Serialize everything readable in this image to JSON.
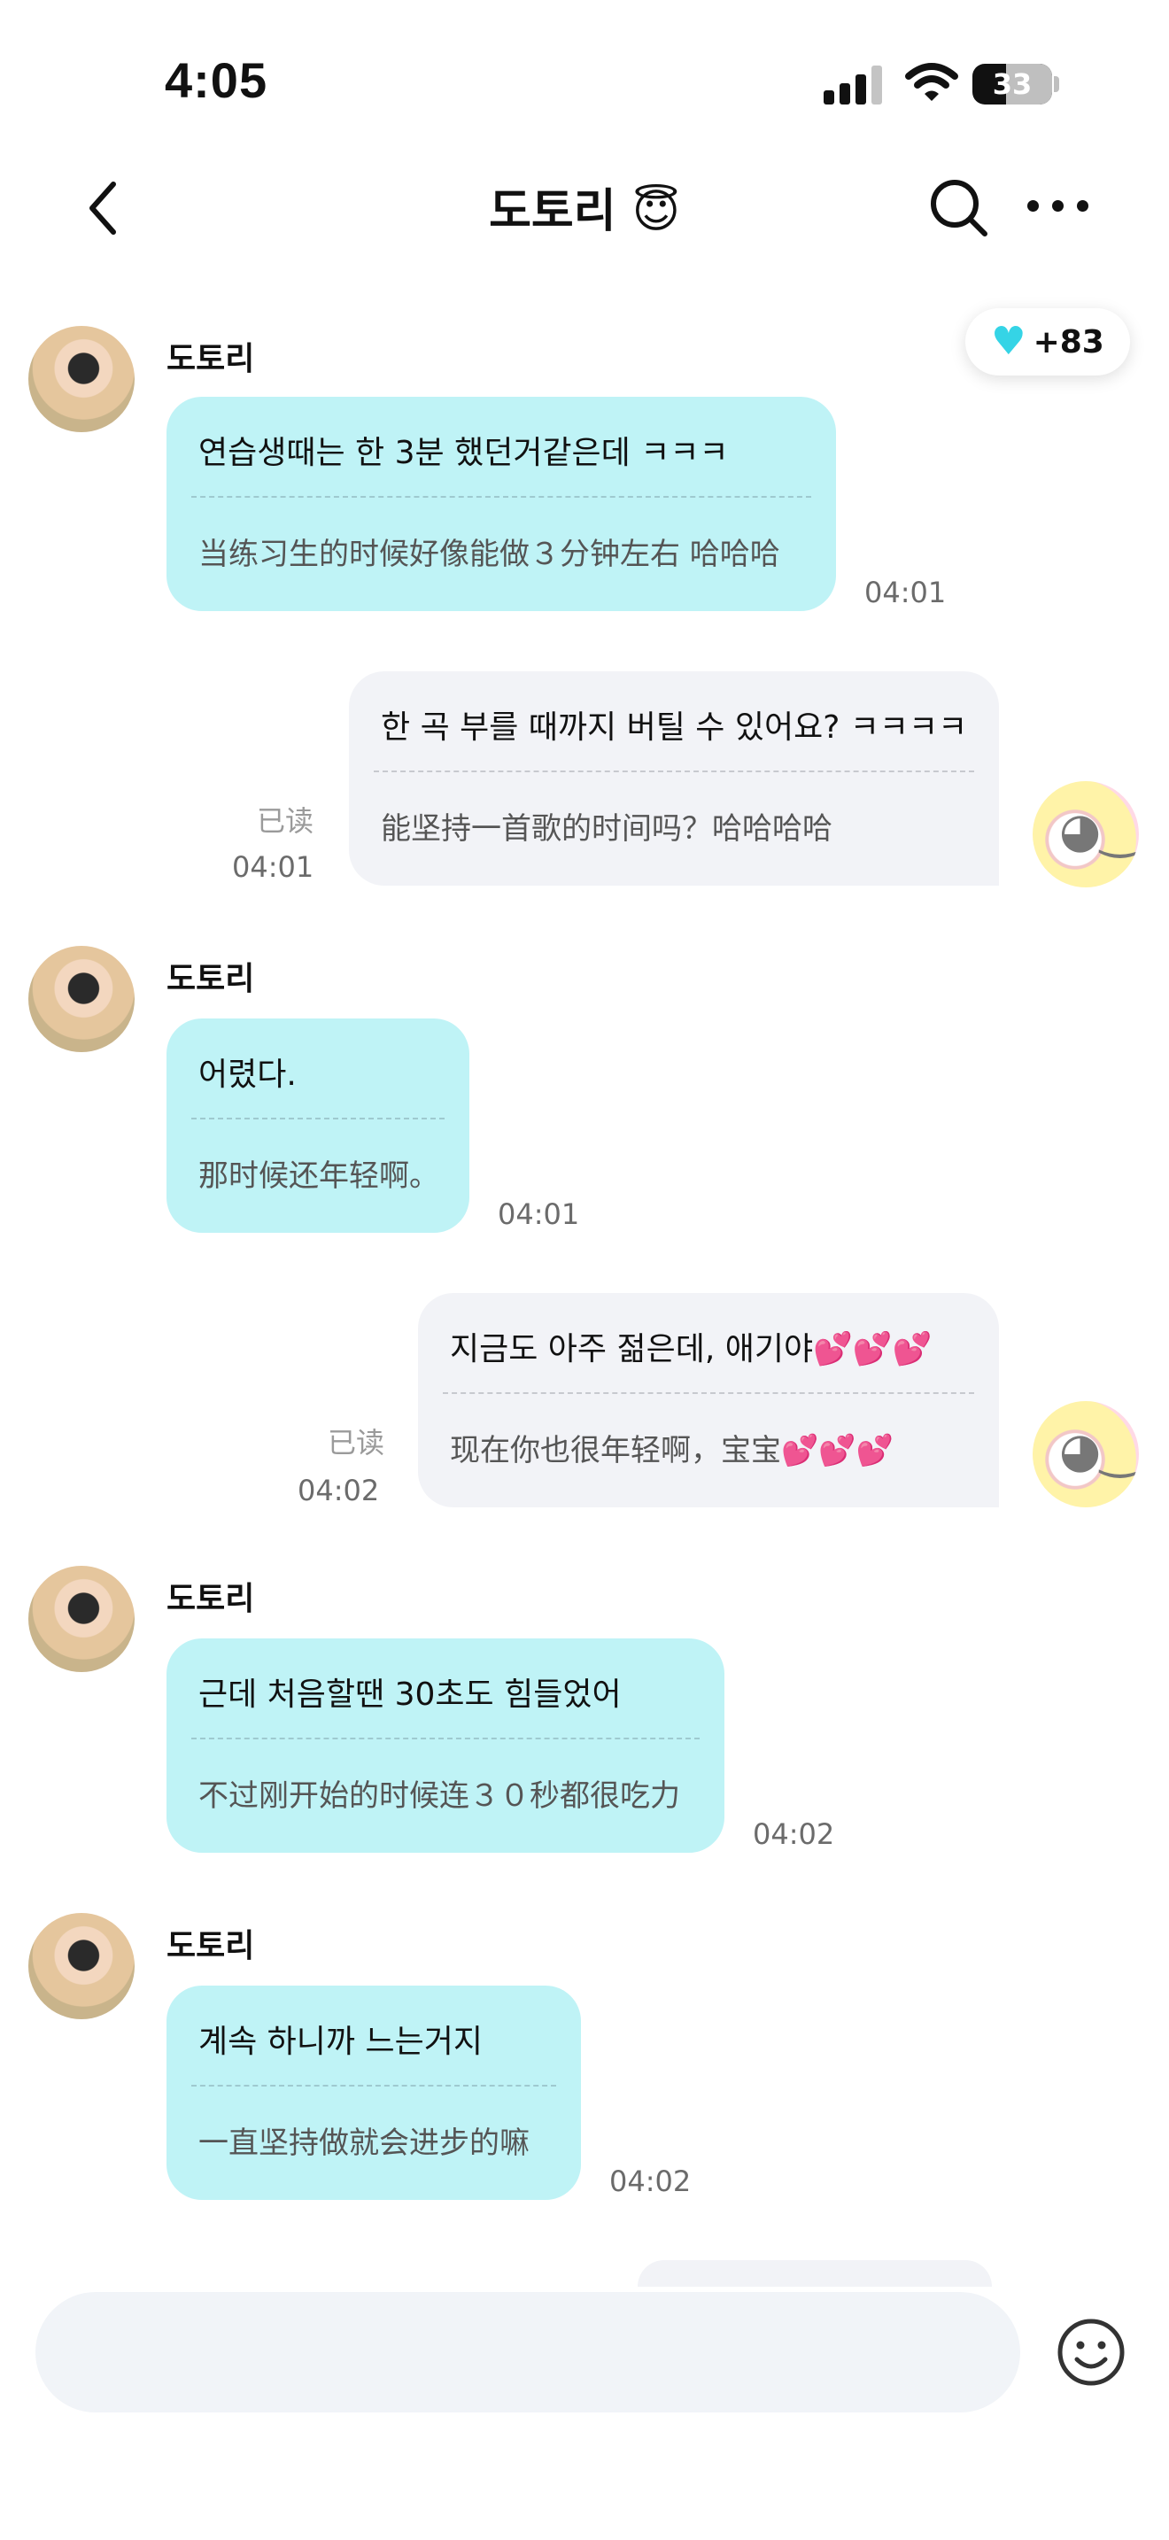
{
  "status_bar": {
    "time": "4:05",
    "battery": "33",
    "icons": [
      "cellular-signal-icon",
      "wifi-icon",
      "battery-icon"
    ]
  },
  "nav": {
    "title": "도토리 😇",
    "icons": [
      "back-chevron-icon",
      "search-icon",
      "more-icon"
    ]
  },
  "heart_badge": {
    "icon": "heart-icon",
    "count": "+83",
    "color": "#35d4e6"
  },
  "colors": {
    "incoming_bubble": "#bff3f6",
    "outgoing_bubble": "#f2f3f7"
  },
  "messages": [
    {
      "sender": "도토리",
      "text": "연습생때는 한 3분 했던거같은데 ㅋㅋㅋ",
      "translation": "当练习生的时候好像能做３分钟左右 哈哈哈",
      "time": "04:01"
    },
    {
      "text": "한 곡 부를 때까지 버틸 수 있어요? ㅋㅋㅋㅋ",
      "translation": "能坚持一首歌的时间吗？哈哈哈哈",
      "read": "已读",
      "time": "04:01"
    },
    {
      "sender": "도토리",
      "text": "어렸다.",
      "translation": "那时候还年轻啊。",
      "time": "04:01"
    },
    {
      "text": "지금도 아주 젊은데, 애기야💕💕💕",
      "translation": "现在你也很年轻啊，宝宝💕💕💕",
      "read": "已读",
      "time": "04:02"
    },
    {
      "sender": "도토리",
      "text": "근데 처음할땐 30초도 힘들었어",
      "translation": "不过刚开始的时候连３０秒都很吃力",
      "time": "04:02"
    },
    {
      "sender": "도토리",
      "text": "계속 하니까 느는거지",
      "translation": "一直坚持做就会进步的嘛",
      "time": "04:02"
    }
  ],
  "input_bar": {
    "placeholder": "",
    "emoji_icon": "smiley-icon"
  }
}
